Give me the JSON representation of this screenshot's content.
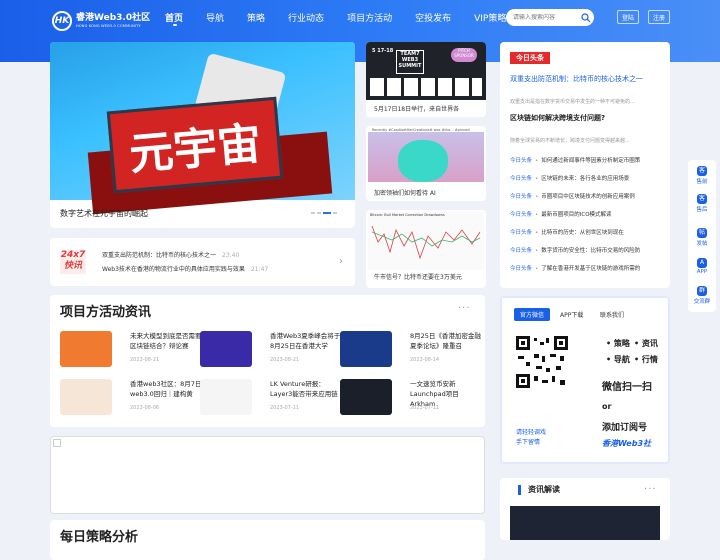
{
  "header": {
    "logo_text": "睿港Web3.0社区",
    "logo_sub": "HONG KONG WEB3.0 COMMUNITY",
    "logo_mark": "HK",
    "nav": [
      "首页",
      "导航",
      "策略",
      "行业动态",
      "项目方活动",
      "空投发布",
      "VIP策略"
    ],
    "search_placeholder": "请输入搜索内容",
    "login": "登陆",
    "register": "注册"
  },
  "hero": {
    "sign_text": "元宇宙",
    "title": "数字艺术在元宇宙的崛起"
  },
  "mini": {
    "logo": "24x7\n快讯",
    "items": [
      {
        "text": "双重支出防范机制：比特币的核心技术之一",
        "time": "23:40"
      },
      {
        "text": "Web3技术在香港的物流行业中的具体应用实践与效果",
        "time": "21:47"
      }
    ]
  },
  "side_cards": [
    {
      "caption": "5月17日18日举行，来自世界各",
      "img_title": "TEAM7 WEB3 SUMMIT",
      "img_badge": "PITCH SPONSOR",
      "img_date": "5 17-18"
    },
    {
      "caption": "加密领袖们如何看待 AI",
      "top_text": "Recently #CanAIsetHerCreations# was #the... #pinned"
    },
    {
      "caption": "牛市信号？比特币还要在3万美元",
      "chart_title": "Bitcoin: Bull Market Correction Drawdowns"
    }
  ],
  "right_news": {
    "logo": "今日头条",
    "head1": "双重支出防范机制：比特币的核心技术之一",
    "para1": "双重支出是指在数字货币交易中发生的一种不可避免的...",
    "head2": "区块链如何解决跨境支付问题?",
    "para2": "随着全球贸易的不断增长，跨境支付问题变得越来越...",
    "tag": "今日头条",
    "items": [
      "如何通过新闻事件等因素分析制定币圈策",
      "区块链的未来：各行各业的应用场景",
      "币圈项目中区块链技术的创新应用案例",
      "最新币圈项目的ICO模式解读",
      "比特币的历史：从创世区块到现在",
      "数字货币的安全性：比特币交易的风险防",
      "了解在香港开发基于区块链的游戏所需的"
    ]
  },
  "sidebar": [
    {
      "label": "售前",
      "glyph": "客"
    },
    {
      "label": "售后",
      "glyph": "客"
    },
    {
      "label": "发帖",
      "glyph": "帖"
    },
    {
      "label": "APP",
      "glyph": "A"
    },
    {
      "label": "交流群",
      "glyph": "群"
    }
  ],
  "projects": {
    "title": "项目方活动资讯",
    "more": "···",
    "items": [
      {
        "title": "未来大模型到底是否需要区块链结合？辩论赛",
        "date": "2023-08-21",
        "color": "#f07a30"
      },
      {
        "title": "香港Web3夏季峰会将于8月25日在香港大学",
        "date": "2023-08-21",
        "color": "#3a2aa8"
      },
      {
        "title": "8月25日《香港加密金融夏季论坛》隆重召",
        "date": "2023-08-14",
        "color": "#1a3a8a"
      },
      {
        "title": "香港web3社区：8月7日web3.0回归｜建构黄",
        "date": "2023-08-06",
        "color": "#f5e6d8"
      },
      {
        "title": "LK Venture研报：Layer3能否带来应用链",
        "date": "2023-07-11",
        "color": "#f5f5f5"
      },
      {
        "title": "一文速览币安新Launchpad项目Arkham",
        "date": "2023-07-11",
        "color": "#1a1f2a"
      }
    ]
  },
  "daily": {
    "title": "每日策略分析"
  },
  "qr": {
    "tabs": [
      "官方微信",
      "APP下载",
      "联系我们"
    ],
    "bullets": [
      "策略",
      "资讯",
      "导航",
      "行情"
    ],
    "scan": "微信扫一扫",
    "or": "or",
    "subscribe": "添加订阅号",
    "brand": "香港Web3社",
    "caption": "请轻轻调戏\n手下留情"
  },
  "insight": {
    "title": "资讯解读",
    "more": "···"
  }
}
